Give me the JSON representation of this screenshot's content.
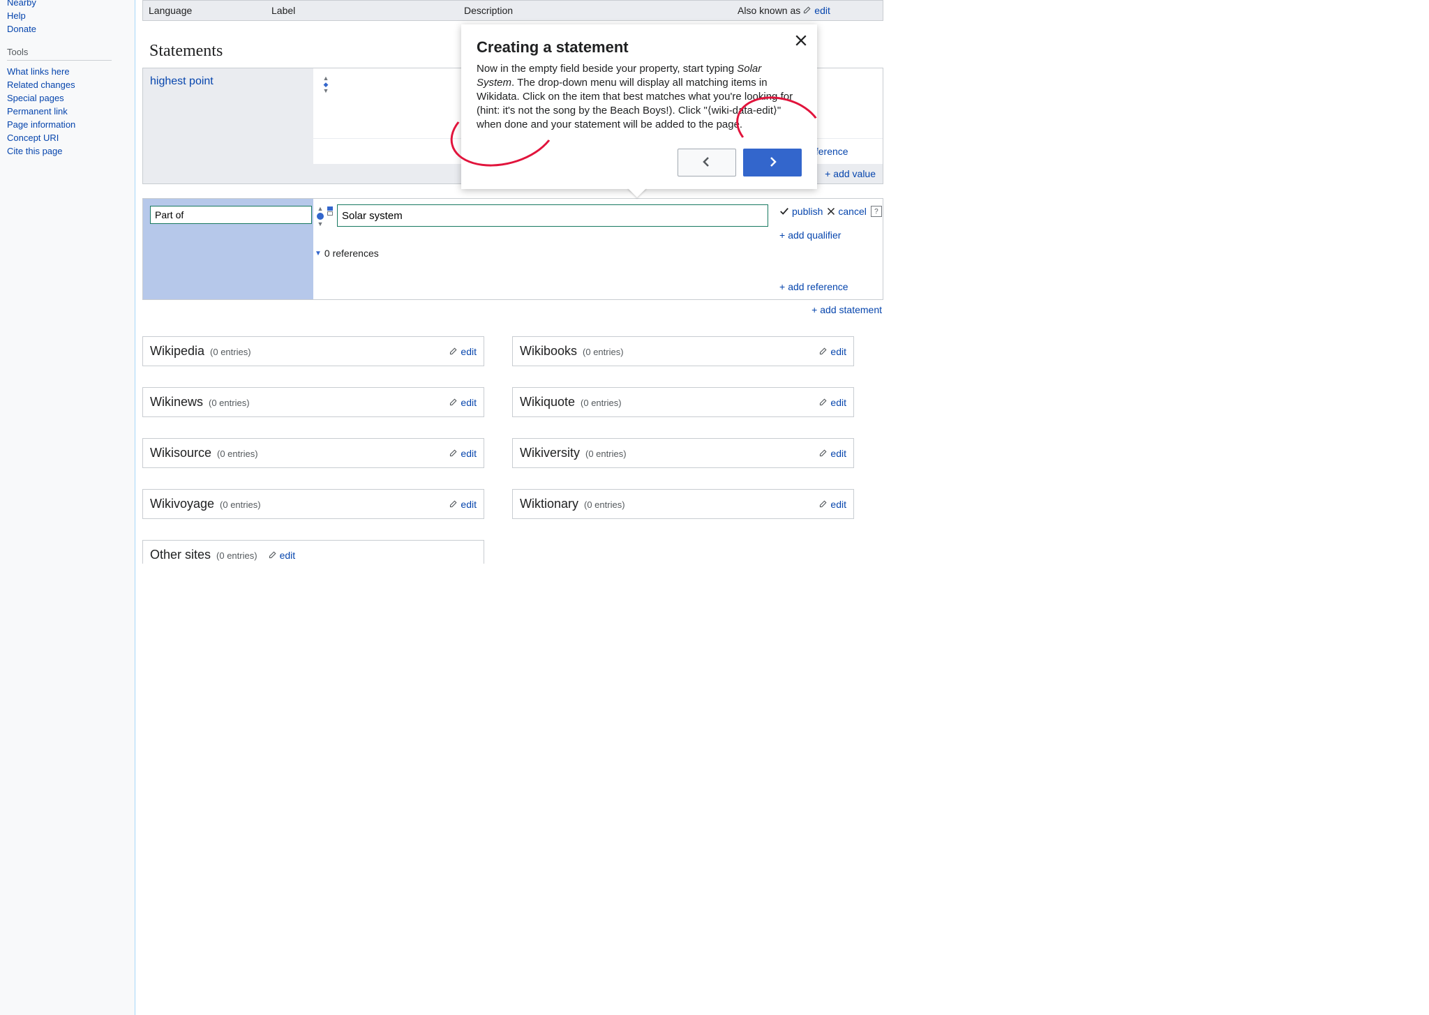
{
  "sidebar": {
    "nav_links": [
      "Nearby",
      "Help",
      "Donate"
    ],
    "tools_head": "Tools",
    "tool_links": [
      "What links here",
      "Related changes",
      "Special pages",
      "Permanent link",
      "Page information",
      "Concept URI",
      "Cite this page"
    ]
  },
  "term_header": {
    "language": "Language",
    "label": "Label",
    "description": "Description",
    "also_known": "Also known as"
  },
  "edit_label": "edit",
  "statements_heading": "Statements",
  "statement_highest_point": {
    "property_label": "highest point",
    "add_reference": "add reference",
    "add_value": "add value"
  },
  "statement_partof": {
    "property_input": "Part of",
    "value_input": "Solar system",
    "publish": "publish",
    "cancel": "cancel",
    "add_qualifier": "add qualifier",
    "references_toggle": "0 references",
    "add_reference": "add reference"
  },
  "add_statement": "add statement",
  "sitelinks": [
    {
      "name": "Wikipedia",
      "count": "(0 entries)"
    },
    {
      "name": "Wikibooks",
      "count": "(0 entries)"
    },
    {
      "name": "Wikinews",
      "count": "(0 entries)"
    },
    {
      "name": "Wikiquote",
      "count": "(0 entries)"
    },
    {
      "name": "Wikisource",
      "count": "(0 entries)"
    },
    {
      "name": "Wikiversity",
      "count": "(0 entries)"
    },
    {
      "name": "Wikivoyage",
      "count": "(0 entries)"
    },
    {
      "name": "Wiktionary",
      "count": "(0 entries)"
    }
  ],
  "other_sites": {
    "name": "Other sites",
    "count": "(0 entries)"
  },
  "tour": {
    "title": "Creating a statement",
    "body_pre": "Now in the empty field beside your property, start typing ",
    "body_em": "Solar System",
    "body_post": ". The drop-down menu will display all matching items in Wikidata. Click on the item that best matches what you're looking for (hint: it's not the song by the Beach Boys!). Click \"⟨wiki-data-edit⟩\" when done and your statement will be added to the page."
  }
}
